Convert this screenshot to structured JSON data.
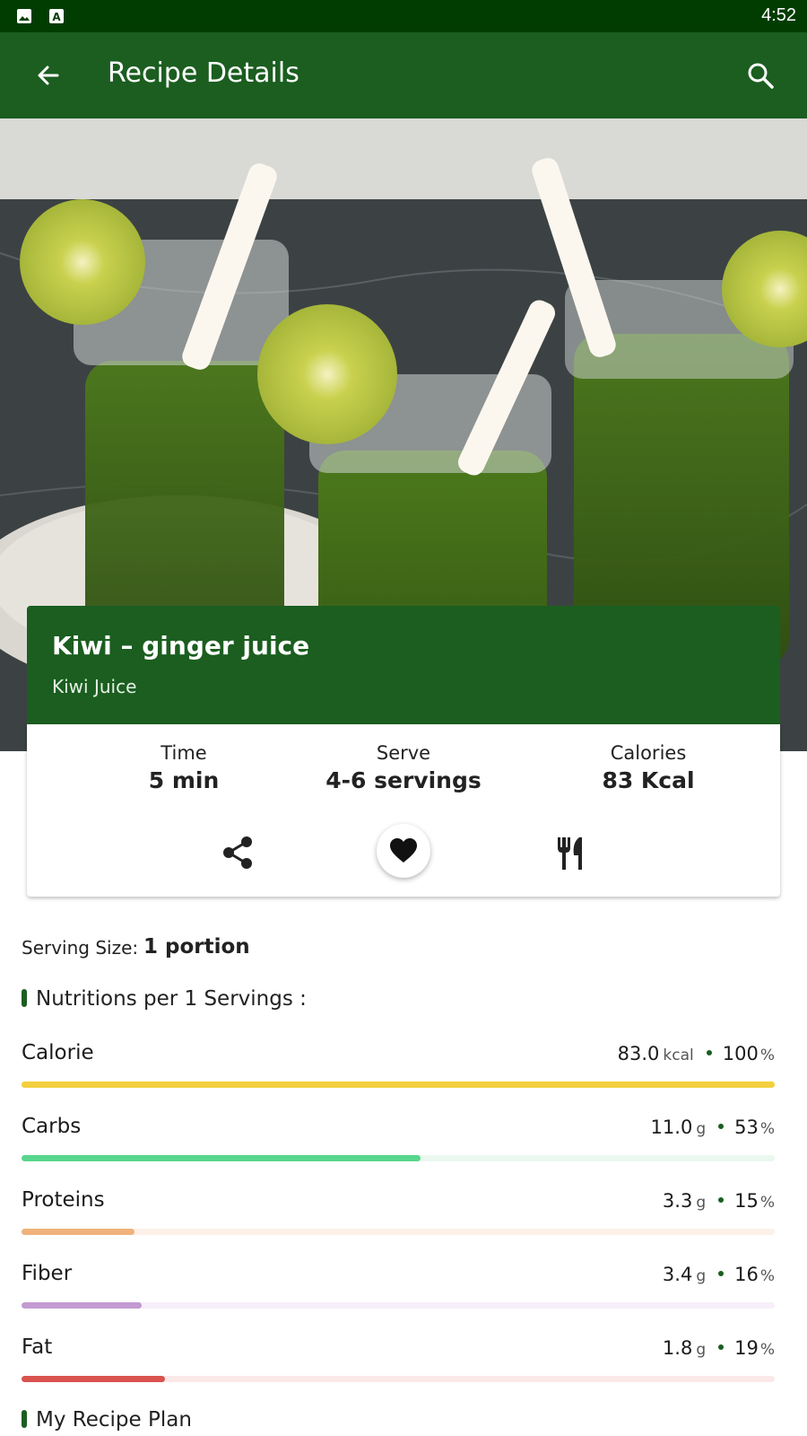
{
  "status_bar": {
    "time": "4:52",
    "icons": [
      "image-icon",
      "text-a-icon"
    ]
  },
  "app_bar": {
    "title": "Recipe Details",
    "back_icon": "back-arrow-icon",
    "search_icon": "search-icon"
  },
  "recipe": {
    "name": "Kiwi – ginger juice",
    "category": "Kiwi Juice",
    "stats": [
      {
        "label": "Time",
        "value": "5 min"
      },
      {
        "label": "Serve",
        "value": "4-6 servings"
      },
      {
        "label": "Calories",
        "value": "83 Kcal"
      }
    ],
    "actions": [
      "share-icon",
      "heart-icon",
      "cutlery-icon"
    ]
  },
  "serving": {
    "label": "Serving Size:",
    "value": "1 portion"
  },
  "nutrition": {
    "title": "Nutritions per 1 Servings :",
    "items": [
      {
        "name": "Calorie",
        "value": "83.0",
        "unit": "kcal",
        "percent": "100",
        "percent_sign": "%",
        "level": 1.0,
        "color": "#f4d03f",
        "track": "#f4d03f"
      },
      {
        "name": "Carbs",
        "value": "11.0",
        "unit": "g",
        "percent": "53",
        "percent_sign": "%",
        "level": 0.53,
        "color": "#58d68d",
        "track": "#eaf8ef"
      },
      {
        "name": "Proteins",
        "value": "3.3",
        "unit": "g",
        "percent": "15",
        "percent_sign": "%",
        "level": 0.15,
        "color": "#f0b27a",
        "track": "#fdf0e8"
      },
      {
        "name": "Fiber",
        "value": "3.4",
        "unit": "g",
        "percent": "16",
        "percent_sign": "%",
        "level": 0.16,
        "color": "#c39bd3",
        "track": "#f7effa"
      },
      {
        "name": "Fat",
        "value": "1.8",
        "unit": "g",
        "percent": "19",
        "percent_sign": "%",
        "level": 0.19,
        "color": "#d9534f",
        "track": "#fbe9e8"
      }
    ]
  },
  "plan": {
    "title": "My Recipe Plan"
  },
  "colors": {
    "primary": "#1b5e20",
    "status": "#013d01"
  }
}
